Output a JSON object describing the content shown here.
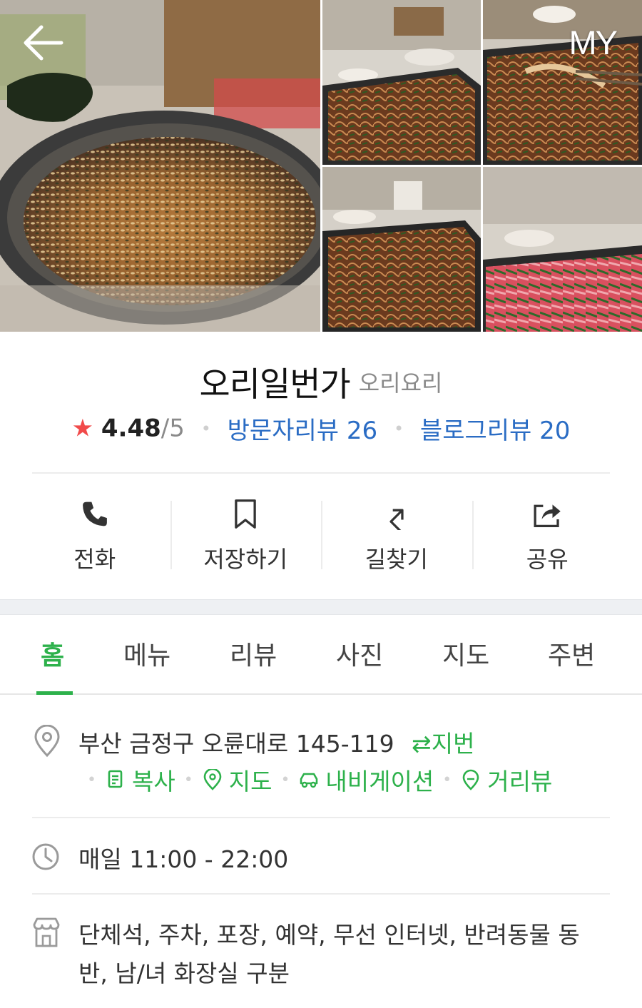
{
  "topbar": {
    "back_icon": "arrow-left-icon",
    "my_label": "MY"
  },
  "gallery": {
    "photo_count": 5,
    "photos": [
      "duck-fried-rice-pan",
      "duck-bulgogi-grill",
      "duck-bulgogi-chopsticks",
      "duck-bulgogi-grill-2",
      "raw-duck-with-chives"
    ]
  },
  "place": {
    "name": "오리일번가",
    "category": "오리요리",
    "rating": "4.48",
    "rating_max": "/5",
    "visitor_reviews": "방문자리뷰 26",
    "blog_reviews": "블로그리뷰 20"
  },
  "actions": [
    {
      "label": "전화",
      "icon": "phone-icon"
    },
    {
      "label": "저장하기",
      "icon": "bookmark-icon"
    },
    {
      "label": "길찾기",
      "icon": "directions-icon"
    },
    {
      "label": "공유",
      "icon": "share-icon"
    }
  ],
  "tabs": [
    {
      "label": "홈",
      "active": true
    },
    {
      "label": "메뉴",
      "active": false
    },
    {
      "label": "리뷰",
      "active": false
    },
    {
      "label": "사진",
      "active": false
    },
    {
      "label": "지도",
      "active": false
    },
    {
      "label": "주변",
      "active": false
    }
  ],
  "info": {
    "address": "부산 금정구 오륜대로 145-119",
    "lot_number_label": "지번",
    "address_links": [
      {
        "label": "복사",
        "icon": "copy-icon"
      },
      {
        "label": "지도",
        "icon": "map-pin-icon"
      },
      {
        "label": "내비게이션",
        "icon": "car-icon"
      },
      {
        "label": "거리뷰",
        "icon": "street-view-icon"
      }
    ],
    "hours": "매일 11:00 - 22:00",
    "amenities_line1": "단체석, 주차, 포장, 예약, 무선 인터넷, 반려동물 동",
    "amenities_line2": "반, 남/녀 화장실 구분"
  },
  "colors": {
    "accent_green": "#2db14b",
    "link_blue": "#2a6cc4",
    "star_red": "#f14a4a"
  }
}
